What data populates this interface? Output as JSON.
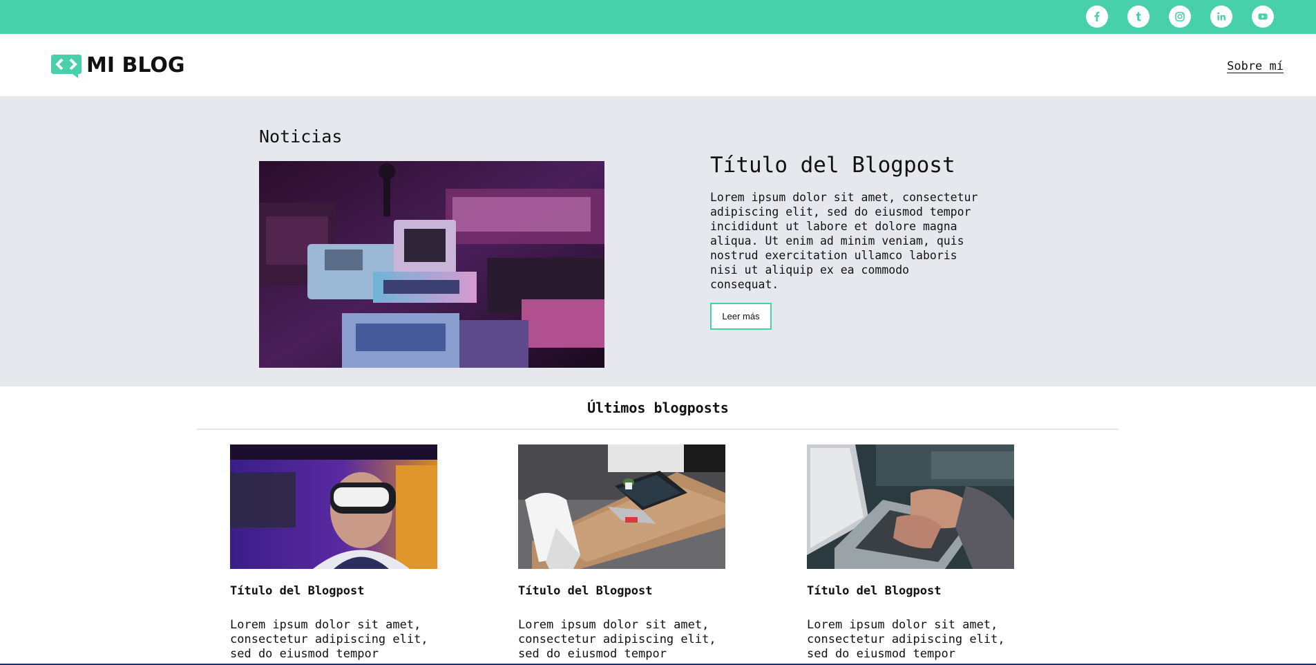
{
  "social_links": [
    {
      "icon": "facebook-icon",
      "glyph": "f"
    },
    {
      "icon": "tumblr-icon",
      "glyph": "t"
    },
    {
      "icon": "instagram-icon",
      "glyph": ""
    },
    {
      "icon": "linkedin-icon",
      "glyph": "in"
    },
    {
      "icon": "youtube-icon",
      "glyph": ""
    }
  ],
  "colors": {
    "accent": "#48d0ab",
    "featured_bg": "#e6e8ed",
    "text": "#111111"
  },
  "header": {
    "logo_text": "MI BLOG",
    "nav_link": "Sobre mí"
  },
  "featured": {
    "section_title": "Noticias",
    "post_title": "Título del Blogpost",
    "post_excerpt": "Lorem ipsum dolor sit amet, consectetur adipiscing elit, sed do eiusmod tempor incididunt ut labore et dolore magna aliqua. Ut enim ad minim veniam, quis nostrud exercitation ullamco laboris nisi ut aliquip ex ea commodo consequat.",
    "read_more": "Leer más"
  },
  "latest": {
    "section_title": "Últimos blogposts",
    "posts": [
      {
        "title": "Título del Blogpost",
        "excerpt": "Lorem ipsum dolor sit amet, consectetur adipiscing elit, sed do eiusmod tempor"
      },
      {
        "title": "Título del Blogpost",
        "excerpt": "Lorem ipsum dolor sit amet, consectetur adipiscing elit, sed do eiusmod tempor"
      },
      {
        "title": "Título del Blogpost",
        "excerpt": "Lorem ipsum dolor sit amet, consectetur adipiscing elit, sed do eiusmod tempor"
      }
    ]
  }
}
